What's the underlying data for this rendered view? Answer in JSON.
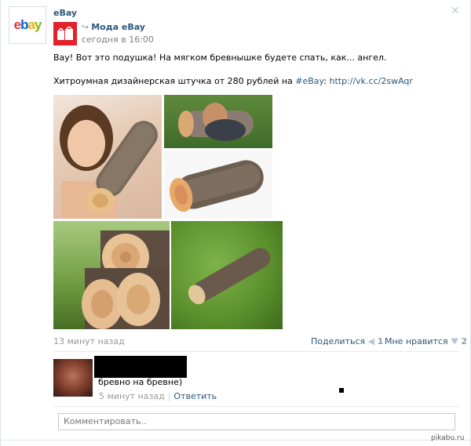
{
  "post": {
    "author": "eBay",
    "repost_name": "Мода eBay",
    "repost_time": "сегодня в 16:00",
    "text_line1": "Вау! Вот это подушка! На мягком бревнышке будете спать, как... ангел.",
    "text_line2_prefix": "Хитроумная дизайнерская штучка от 280 рублей на ",
    "hashtag": "#eBay",
    "text_line2_mid": ": ",
    "url": "http://vk.cc/2swAqr",
    "time_ago": "13 минут назад"
  },
  "actions": {
    "share_label": "Поделиться",
    "share_count": "1",
    "like_label": "Мне нравится",
    "like_count": "2"
  },
  "comment": {
    "text": "бревно на бревне)",
    "time": "5 минут назад",
    "reply_label": "Ответить"
  },
  "comment_input": {
    "placeholder": "Комментировать.."
  },
  "logo_text": {
    "e": "e",
    "b": "b",
    "a": "a",
    "y": "y"
  },
  "watermark": "pikabu.ru",
  "colors": {
    "link": "#2b587a",
    "muted": "#999999",
    "ebay_red": "#e53238",
    "ebay_blue": "#0064d2",
    "ebay_yellow": "#f5af02",
    "ebay_green": "#86b817"
  }
}
